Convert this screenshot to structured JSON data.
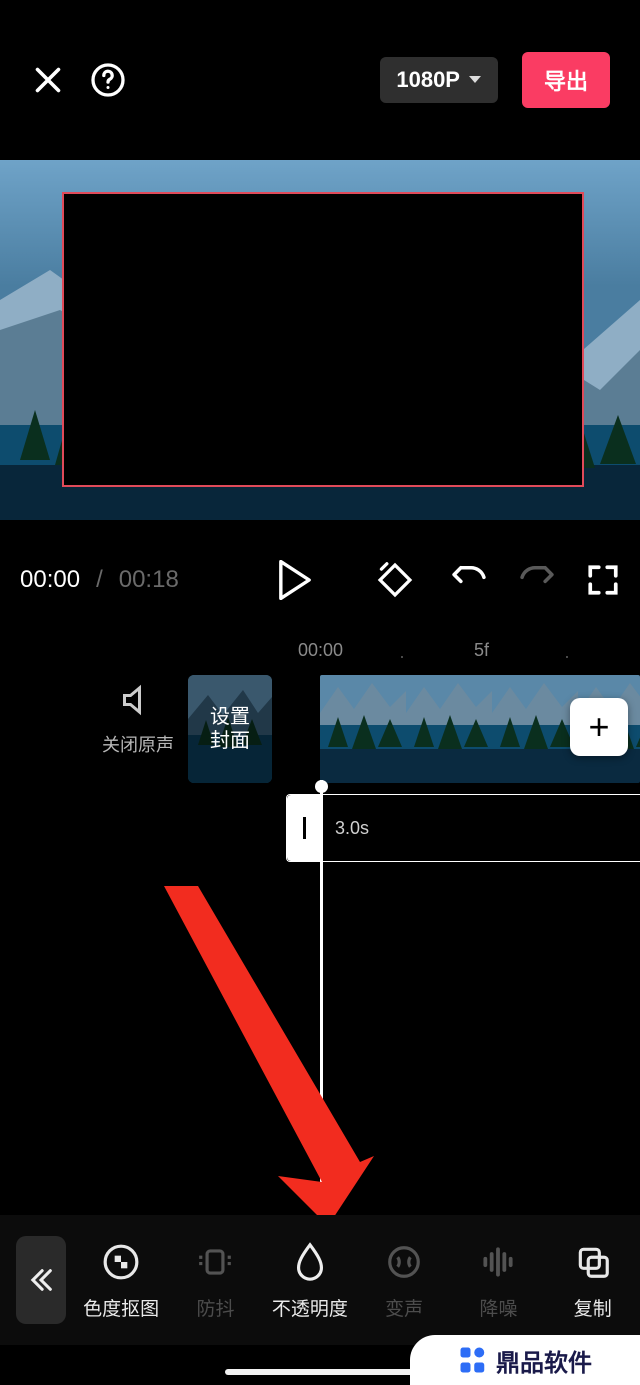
{
  "header": {
    "resolution": "1080P",
    "export": "导出"
  },
  "time": {
    "current": "00:00",
    "sep": "/",
    "total": "00:18"
  },
  "ruler": {
    "t00": "00:00",
    "t5f": "5f"
  },
  "track": {
    "mute": "关闭原声",
    "cover": "设置\n封面",
    "duration": "3.0s",
    "add": "+"
  },
  "tools": {
    "chroma": "色度抠图",
    "stabilize": "防抖",
    "opacity": "不透明度",
    "voice": "变声",
    "noise": "降噪",
    "copy": "复制"
  },
  "watermark": "鼎品软件"
}
